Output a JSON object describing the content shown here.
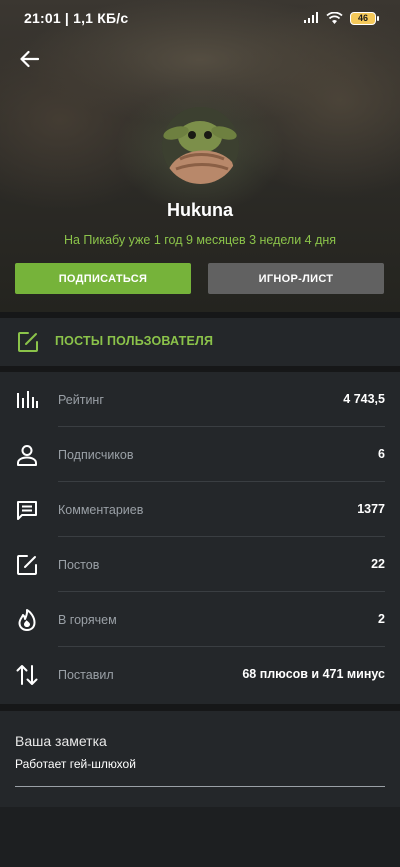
{
  "status_bar": {
    "time_speed": "21:01 | 1,1 КБ/с",
    "battery": "46"
  },
  "profile": {
    "username": "Hukuna",
    "member_since": "На Пикабу уже 1 год 9 месяцев 3 недели 4 дня",
    "subscribe_label": "ПОДПИСАТЬСЯ",
    "ignore_label": "ИГНОР-ЛИСТ"
  },
  "posts_link": {
    "label": "ПОСТЫ ПОЛЬЗОВАТЕЛЯ",
    "icon": "edit-icon"
  },
  "stats": [
    {
      "icon": "bar-chart-icon",
      "label": "Рейтинг",
      "value": "4 743,5"
    },
    {
      "icon": "person-icon",
      "label": "Подписчиков",
      "value": "6"
    },
    {
      "icon": "comment-icon",
      "label": "Комментариев",
      "value": "1377"
    },
    {
      "icon": "edit-icon",
      "label": "Постов",
      "value": "22"
    },
    {
      "icon": "flame-icon",
      "label": "В горячем",
      "value": "2"
    },
    {
      "icon": "swap-vertical-icon",
      "label": "Поставил",
      "value": "68 плюсов и 471 минус"
    }
  ],
  "note": {
    "title": "Ваша заметка",
    "text": "Работает гей-шлюхой"
  },
  "colors": {
    "accent_green": "#8bc34a",
    "subscribe_bg": "#76b33a",
    "ignore_bg": "#616161",
    "panel_bg": "#24272a",
    "page_bg": "#1d1f21"
  }
}
